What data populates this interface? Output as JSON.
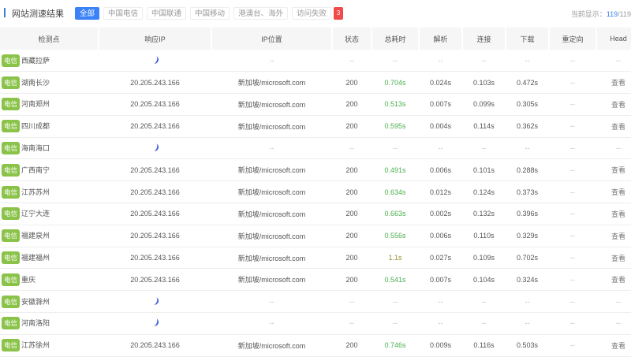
{
  "header": {
    "title": "网站测速结果",
    "tabs": [
      "全部",
      "中国电信",
      "中国联通",
      "中国移动",
      "港澳台、海外",
      "访问失败"
    ],
    "fail_count": "3",
    "count_label": "当前显示：",
    "count_current": "119",
    "count_total": "/119"
  },
  "columns": [
    "检测点",
    "响应IP",
    "IP位置",
    "状态",
    "总耗时",
    "解析",
    "连接",
    "下载",
    "重定向",
    "Head"
  ],
  "colors": {
    "accent": "#3b82f6",
    "isp_tag": "#8bc34a",
    "fast": "#4caf50",
    "fail_badge": "#f24a4a"
  },
  "rows": [
    {
      "isp": "电信",
      "node": "西藏拉萨",
      "loading": true,
      "ip": "",
      "loc": "--",
      "status": "--",
      "total": "--",
      "dns": "--",
      "connect": "--",
      "download": "--",
      "redirect": "--",
      "head": "--"
    },
    {
      "isp": "电信",
      "node": "湖南长沙",
      "ip": "20.205.243.166",
      "loc": "新加坡/microsoft.com",
      "status": "200",
      "total": "0.704s",
      "dns": "0.024s",
      "connect": "0.103s",
      "download": "0.472s",
      "redirect": "--",
      "head": "查看"
    },
    {
      "isp": "电信",
      "node": "河南郑州",
      "ip": "20.205.243.166",
      "loc": "新加坡/microsoft.com",
      "status": "200",
      "total": "0.513s",
      "dns": "0.007s",
      "connect": "0.099s",
      "download": "0.305s",
      "redirect": "--",
      "head": "查看"
    },
    {
      "isp": "电信",
      "node": "四川成都",
      "ip": "20.205.243.166",
      "loc": "新加坡/microsoft.com",
      "status": "200",
      "total": "0.595s",
      "dns": "0.004s",
      "connect": "0.114s",
      "download": "0.362s",
      "redirect": "--",
      "head": "查看"
    },
    {
      "isp": "电信",
      "node": "海南海口",
      "loading": true,
      "ip": "",
      "loc": "--",
      "status": "--",
      "total": "--",
      "dns": "--",
      "connect": "--",
      "download": "--",
      "redirect": "--",
      "head": "--"
    },
    {
      "isp": "电信",
      "node": "广西南宁",
      "ip": "20.205.243.166",
      "loc": "新加坡/microsoft.com",
      "status": "200",
      "total": "0.491s",
      "dns": "0.006s",
      "connect": "0.101s",
      "download": "0.288s",
      "redirect": "--",
      "head": "查看"
    },
    {
      "isp": "电信",
      "node": "江苏苏州",
      "ip": "20.205.243.166",
      "loc": "新加坡/microsoft.com",
      "status": "200",
      "total": "0.634s",
      "dns": "0.012s",
      "connect": "0.124s",
      "download": "0.373s",
      "redirect": "--",
      "head": "查看"
    },
    {
      "isp": "电信",
      "node": "辽宁大连",
      "ip": "20.205.243.166",
      "loc": "新加坡/microsoft.com",
      "status": "200",
      "total": "0.663s",
      "dns": "0.002s",
      "connect": "0.132s",
      "download": "0.396s",
      "redirect": "--",
      "head": "查看"
    },
    {
      "isp": "电信",
      "node": "福建泉州",
      "ip": "20.205.243.166",
      "loc": "新加坡/microsoft.com",
      "status": "200",
      "total": "0.556s",
      "dns": "0.006s",
      "connect": "0.110s",
      "download": "0.329s",
      "redirect": "--",
      "head": "查看"
    },
    {
      "isp": "电信",
      "node": "福建福州",
      "ip": "20.205.243.166",
      "loc": "新加坡/microsoft.com",
      "status": "200",
      "total": "1.1s",
      "dns": "0.027s",
      "connect": "0.109s",
      "download": "0.702s",
      "redirect": "--",
      "head": "查看",
      "slow": true
    },
    {
      "isp": "电信",
      "node": "重庆",
      "ip": "20.205.243.166",
      "loc": "新加坡/microsoft.com",
      "status": "200",
      "total": "0.541s",
      "dns": "0.007s",
      "connect": "0.104s",
      "download": "0.324s",
      "redirect": "--",
      "head": "查看"
    },
    {
      "isp": "电信",
      "node": "安徽滁州",
      "loading": true,
      "ip": "",
      "loc": "--",
      "status": "--",
      "total": "--",
      "dns": "--",
      "connect": "--",
      "download": "--",
      "redirect": "--",
      "head": "--"
    },
    {
      "isp": "电信",
      "node": "河南洛阳",
      "loading": true,
      "ip": "",
      "loc": "--",
      "status": "--",
      "total": "--",
      "dns": "--",
      "connect": "--",
      "download": "--",
      "redirect": "--",
      "head": "--"
    },
    {
      "isp": "电信",
      "node": "江苏徐州",
      "ip": "20.205.243.166",
      "loc": "新加坡/microsoft.com",
      "status": "200",
      "total": "0.746s",
      "dns": "0.009s",
      "connect": "0.116s",
      "download": "0.503s",
      "redirect": "--",
      "head": "查看"
    }
  ]
}
